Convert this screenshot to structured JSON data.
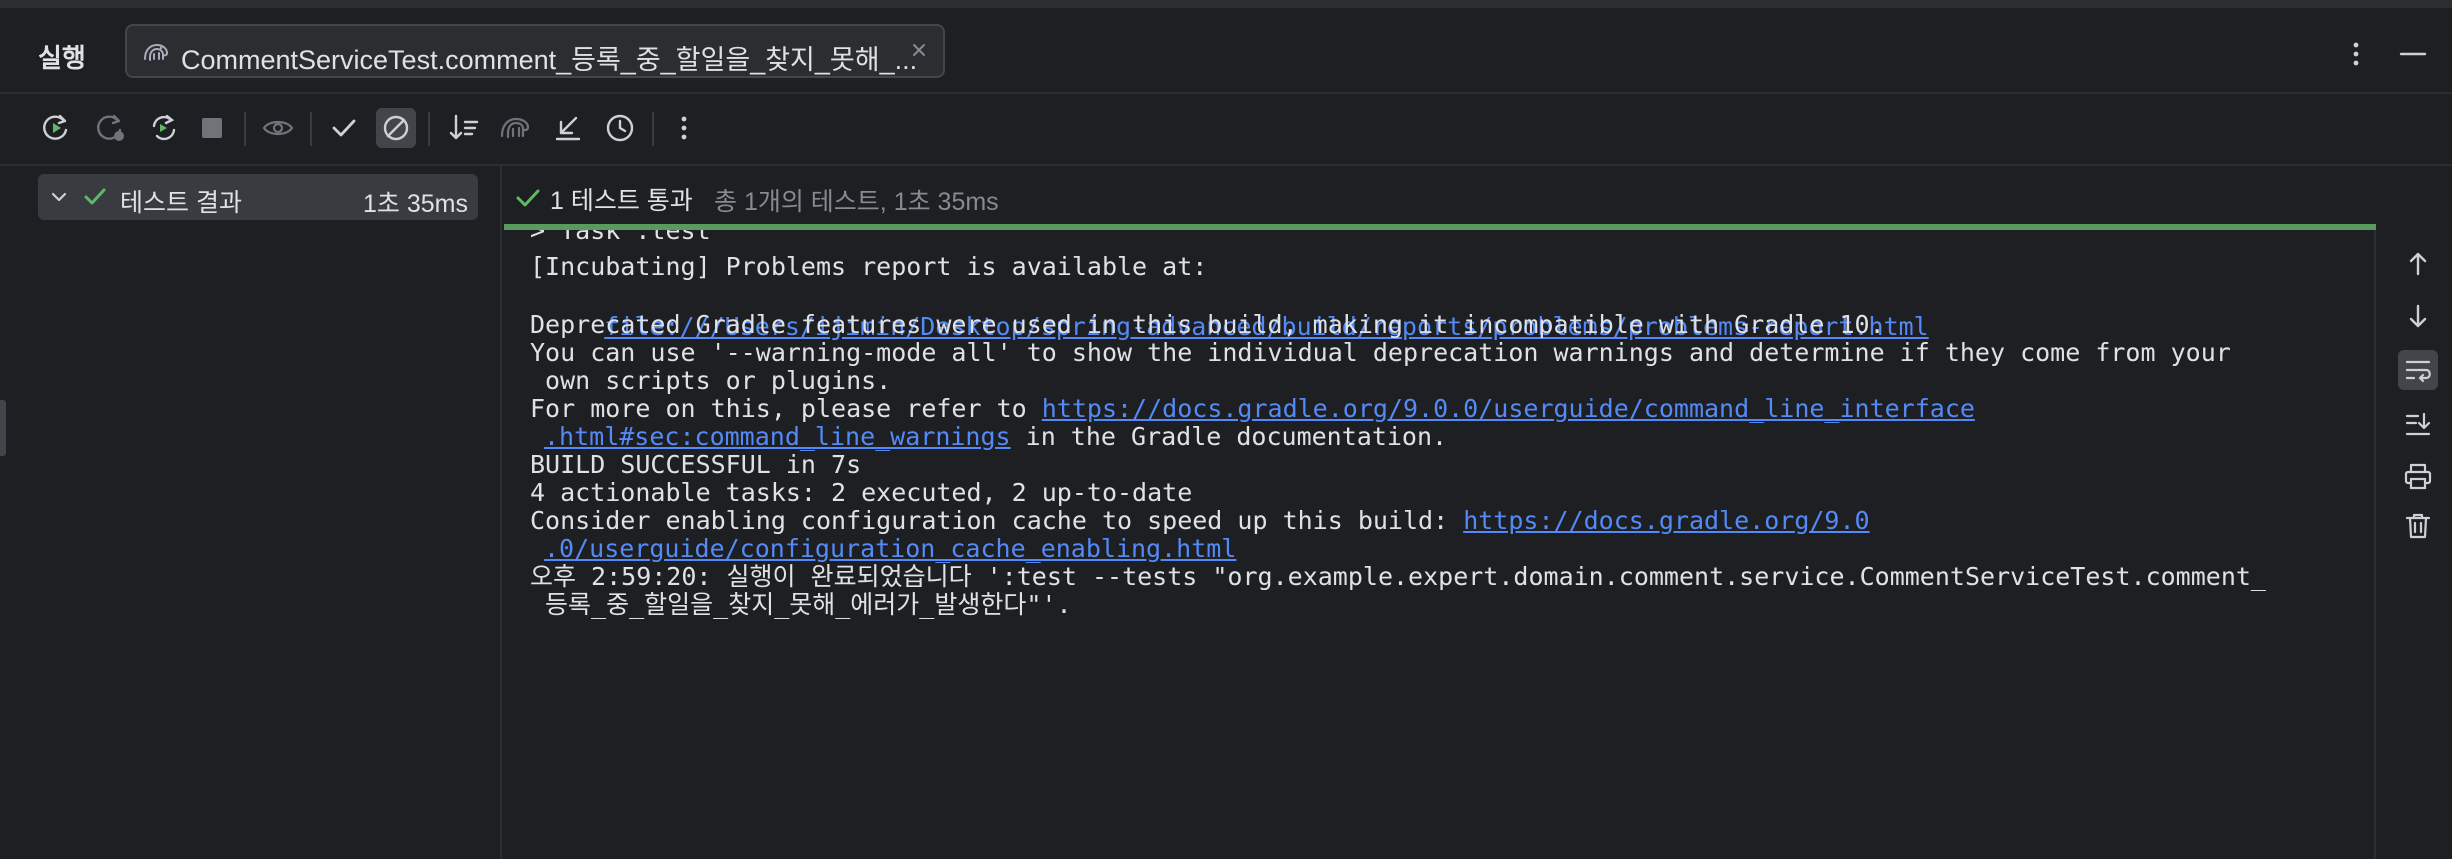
{
  "header": {
    "title": "실행",
    "tab_label": "CommentServiceTest.comment_등록_중_할일을_찾지_못해_..."
  },
  "toolbar": {
    "buttons": [
      "rerun-icon",
      "rerun-failed-icon",
      "rerun-auto-icon",
      "stop-icon",
      "show-ignored-icon",
      "show-passed-icon",
      "show-ignored-toggle-icon",
      "sort-icon",
      "import-tests-icon",
      "export-tests-icon",
      "history-icon",
      "more-icon"
    ]
  },
  "tree": {
    "root_label": "테스트 결과",
    "root_time": "1초 35ms"
  },
  "status": {
    "passed": "1 테스트 통과",
    "summary": "총 1개의 테스트, 1초 35ms"
  },
  "console": {
    "line0": "> Task :test",
    "line1": "[Incubating] Problems report is available at:",
    "line2_link": "file:///Users/ijimin/Desktop/spring-advanced/build/reports/problems/problems-report.html",
    "line3": "Deprecated Gradle features were used in this build, making it incompatible with Gradle 10.",
    "line4": "You can use '--warning-mode all' to show the individual deprecation warnings and determine if they come from your",
    "line5": " own scripts or plugins.",
    "line6_text": "For more on this, please refer to ",
    "line6_link": "https://docs.gradle.org/9.0.0/userguide/command_line_interface",
    "line7_link": ".html#sec:command_line_warnings",
    "line7_text": " in the Gradle documentation.",
    "line8": "BUILD SUCCESSFUL in 7s",
    "line9": "4 actionable tasks: 2 executed, 2 up-to-date",
    "line10_text": "Consider enabling configuration cache to speed up this build: ",
    "line10_link": "https://docs.gradle.org/9.0",
    "line11_link": ".0/userguide/configuration_cache_enabling.html",
    "line12": "오후 2:59:20: 실행이 완료되었습니다 ':test --tests \"org.example.expert.domain.comment.service.CommentServiceTest.comment_",
    "line13": " 등록_중_할일을_찾지_못해_에러가_발생한다\"'."
  },
  "colors": {
    "background": "#1e1f22",
    "panel": "#2b2d30",
    "success": "#5fb865",
    "link": "#548af7",
    "progress": "#5a9a5f"
  }
}
